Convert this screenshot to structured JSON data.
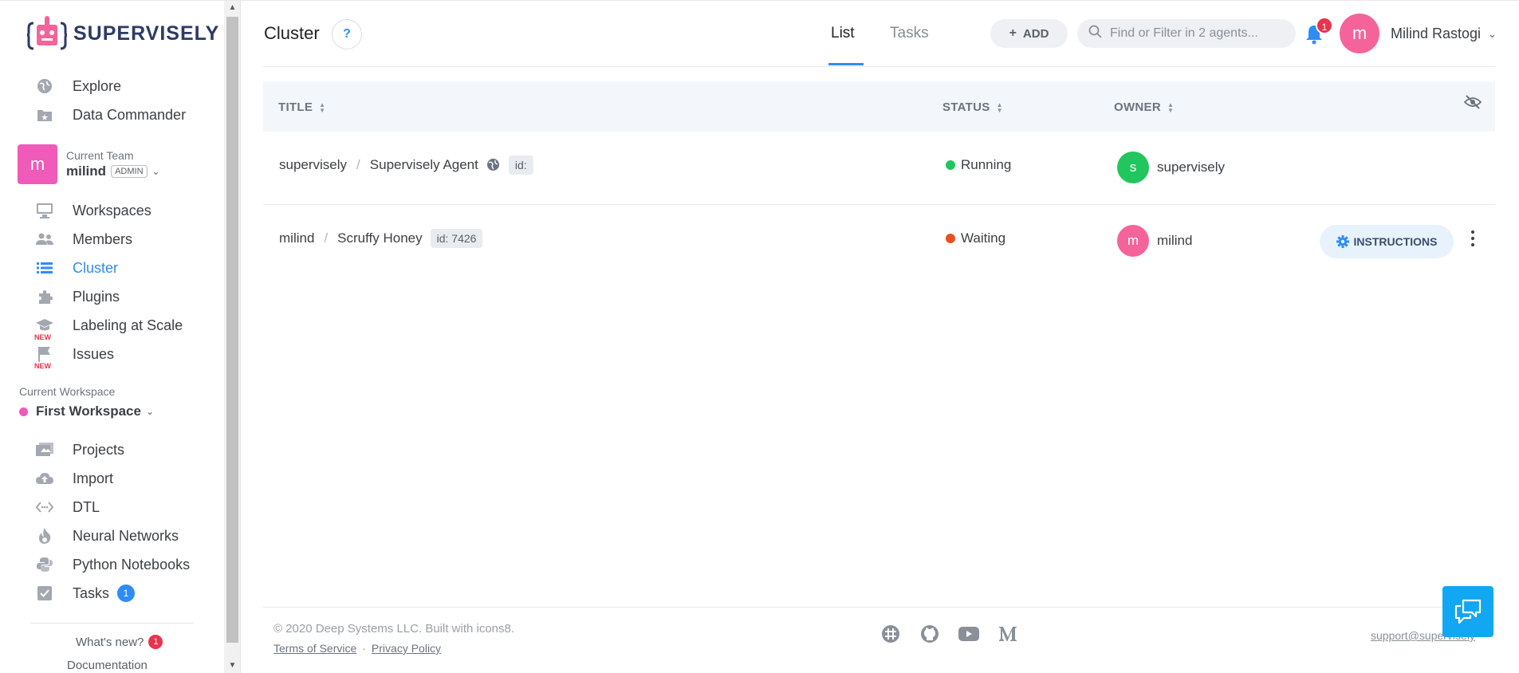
{
  "app": {
    "brand": "SUPERVISELY",
    "accent_color": "#2f8cf5"
  },
  "sidebar": {
    "top_items": [
      {
        "label": "Explore",
        "icon": "globe-icon"
      },
      {
        "label": "Data Commander",
        "icon": "folder-star-icon"
      }
    ],
    "team": {
      "caption": "Current Team",
      "avatar_letter": "m",
      "name": "milind",
      "role": "ADMIN"
    },
    "team_items": [
      {
        "label": "Workspaces",
        "icon": "monitor-icon"
      },
      {
        "label": "Members",
        "icon": "people-icon"
      },
      {
        "label": "Cluster",
        "icon": "list-icon",
        "active": true
      },
      {
        "label": "Plugins",
        "icon": "puzzle-icon"
      },
      {
        "label": "Labeling at Scale",
        "icon": "graduation-cap-icon",
        "tag": "NEW"
      },
      {
        "label": "Issues",
        "icon": "flag-icon",
        "tag": "NEW"
      }
    ],
    "workspace": {
      "caption": "Current Workspace",
      "name": "First Workspace",
      "dot_color": "#f05ab8"
    },
    "workspace_items": [
      {
        "label": "Projects",
        "icon": "images-icon"
      },
      {
        "label": "Import",
        "icon": "cloud-upload-icon"
      },
      {
        "label": "DTL",
        "icon": "code-arrows-icon"
      },
      {
        "label": "Neural Networks",
        "icon": "flame-icon"
      },
      {
        "label": "Python Notebooks",
        "icon": "python-icon"
      },
      {
        "label": "Tasks",
        "icon": "checkbox-icon",
        "count": "1"
      }
    ],
    "whats_new": {
      "label": "What's new?",
      "count": "1"
    },
    "documentation": "Documentation"
  },
  "header": {
    "title": "Cluster",
    "help": "?",
    "tabs": [
      {
        "label": "List",
        "active": true
      },
      {
        "label": "Tasks",
        "active": false
      }
    ],
    "add_label": "ADD",
    "search_placeholder": "Find or Filter in 2 agents...",
    "notifications_count": "1",
    "user": {
      "avatar_letter": "m",
      "name": "Milind Rastogi"
    }
  },
  "table": {
    "columns": [
      "TITLE",
      "STATUS",
      "OWNER"
    ],
    "rows": [
      {
        "owner_path": "supervisely",
        "agent_name": "Supervisely Agent",
        "public": true,
        "id_label": "id:",
        "status": "Running",
        "status_color": "#22c55e",
        "owner_letter": "s",
        "owner_name": "supervisely",
        "owner_color": "#22c55e"
      },
      {
        "owner_path": "milind",
        "agent_name": "Scruffy Honey",
        "public": false,
        "id_label": "id: 7426",
        "status": "Waiting",
        "status_color": "#e8501c",
        "owner_letter": "m",
        "owner_name": "milind",
        "owner_color": "#f4649b",
        "action_label": "INSTRUCTIONS"
      }
    ]
  },
  "footer": {
    "copyright": "© 2020 Deep Systems LLC. Built with icons8.",
    "terms": "Terms of Service",
    "privacy": "Privacy Policy",
    "support": "support@supervisely"
  }
}
